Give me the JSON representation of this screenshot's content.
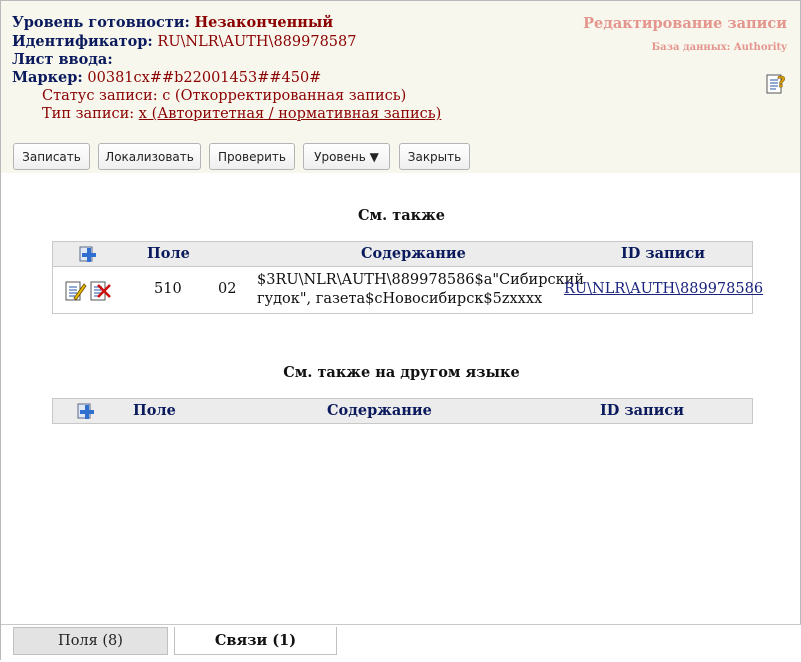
{
  "header": {
    "readiness_label": "Уровень готовности:",
    "readiness_value": "Незаконченный",
    "identifier_label": "Идентификатор:",
    "identifier_value": "RU\\NLR\\AUTH\\889978587",
    "input_sheet_label": "Лист ввода:",
    "input_sheet_value": "",
    "marker_label": "Маркер:",
    "marker_value": "00381cx##b22001453##450#",
    "record_status": "Статус записи: c (Откорректированная запись)",
    "record_type_label": "Тип записи:",
    "record_type_value": "x (Авторитетная / нормативная запись)",
    "edit_title": "Редактирование записи",
    "database": "База данных: Authority",
    "help_icon": "help-icon"
  },
  "toolbar": {
    "save": "Записать",
    "localize": "Локализовать",
    "check": "Проверить",
    "level": "Уровень ▼",
    "close": "Закрыть"
  },
  "see_also": {
    "title": "См. также",
    "columns": {
      "field": "Поле",
      "content": "Содержание",
      "id": "ID записи"
    },
    "rows": [
      {
        "field": "510",
        "indicator": "02",
        "content_line1": "$3RU\\NLR\\AUTH\\889978586$a\"Сибирский",
        "content_line2": "гудок\", газета$cНовосибирск$5zxxxx",
        "record_id": "RU\\NLR\\AUTH\\889978586"
      }
    ]
  },
  "see_also_other_lang": {
    "title": "См. также на другом языке",
    "columns": {
      "field": "Поле",
      "content": "Содержание",
      "id": "ID записи"
    }
  },
  "tabs": {
    "fields": "Поля (8)",
    "links": "Связи (1)"
  },
  "colors": {
    "label": "#0a1a5c",
    "value": "#8b0000",
    "title_pink": "#e4958d",
    "header_bg": "#f8f7ee"
  }
}
